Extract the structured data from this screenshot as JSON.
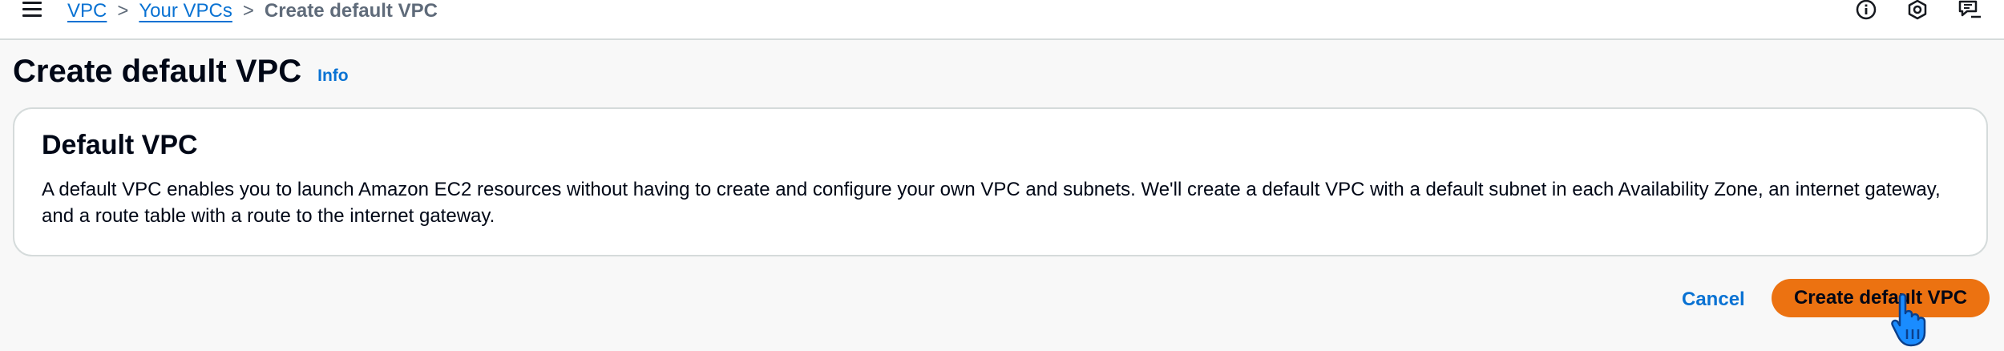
{
  "breadcrumb": {
    "items": [
      "VPC",
      "Your VPCs"
    ],
    "separator": ">",
    "current": "Create default VPC"
  },
  "header": {
    "title": "Create default VPC",
    "info_label": "Info"
  },
  "panel": {
    "title": "Default VPC",
    "description": "A default VPC enables you to launch Amazon EC2 resources without having to create and configure your own VPC and subnets. We'll create a default VPC with a default subnet in each Availability Zone, an internet gateway, and a route table with a route to the internet gateway."
  },
  "actions": {
    "cancel_label": "Cancel",
    "submit_label": "Create default VPC"
  },
  "icons": {
    "menu": "hamburger-menu-icon",
    "info": "info-circle-icon",
    "notifications": "notification-icon",
    "feedback": "feedback-icon",
    "cursor": "hand-pointer-cursor"
  },
  "colors": {
    "link": "#0972d3",
    "primary_button": "#ec7211",
    "cursor": "#1a8cff"
  }
}
